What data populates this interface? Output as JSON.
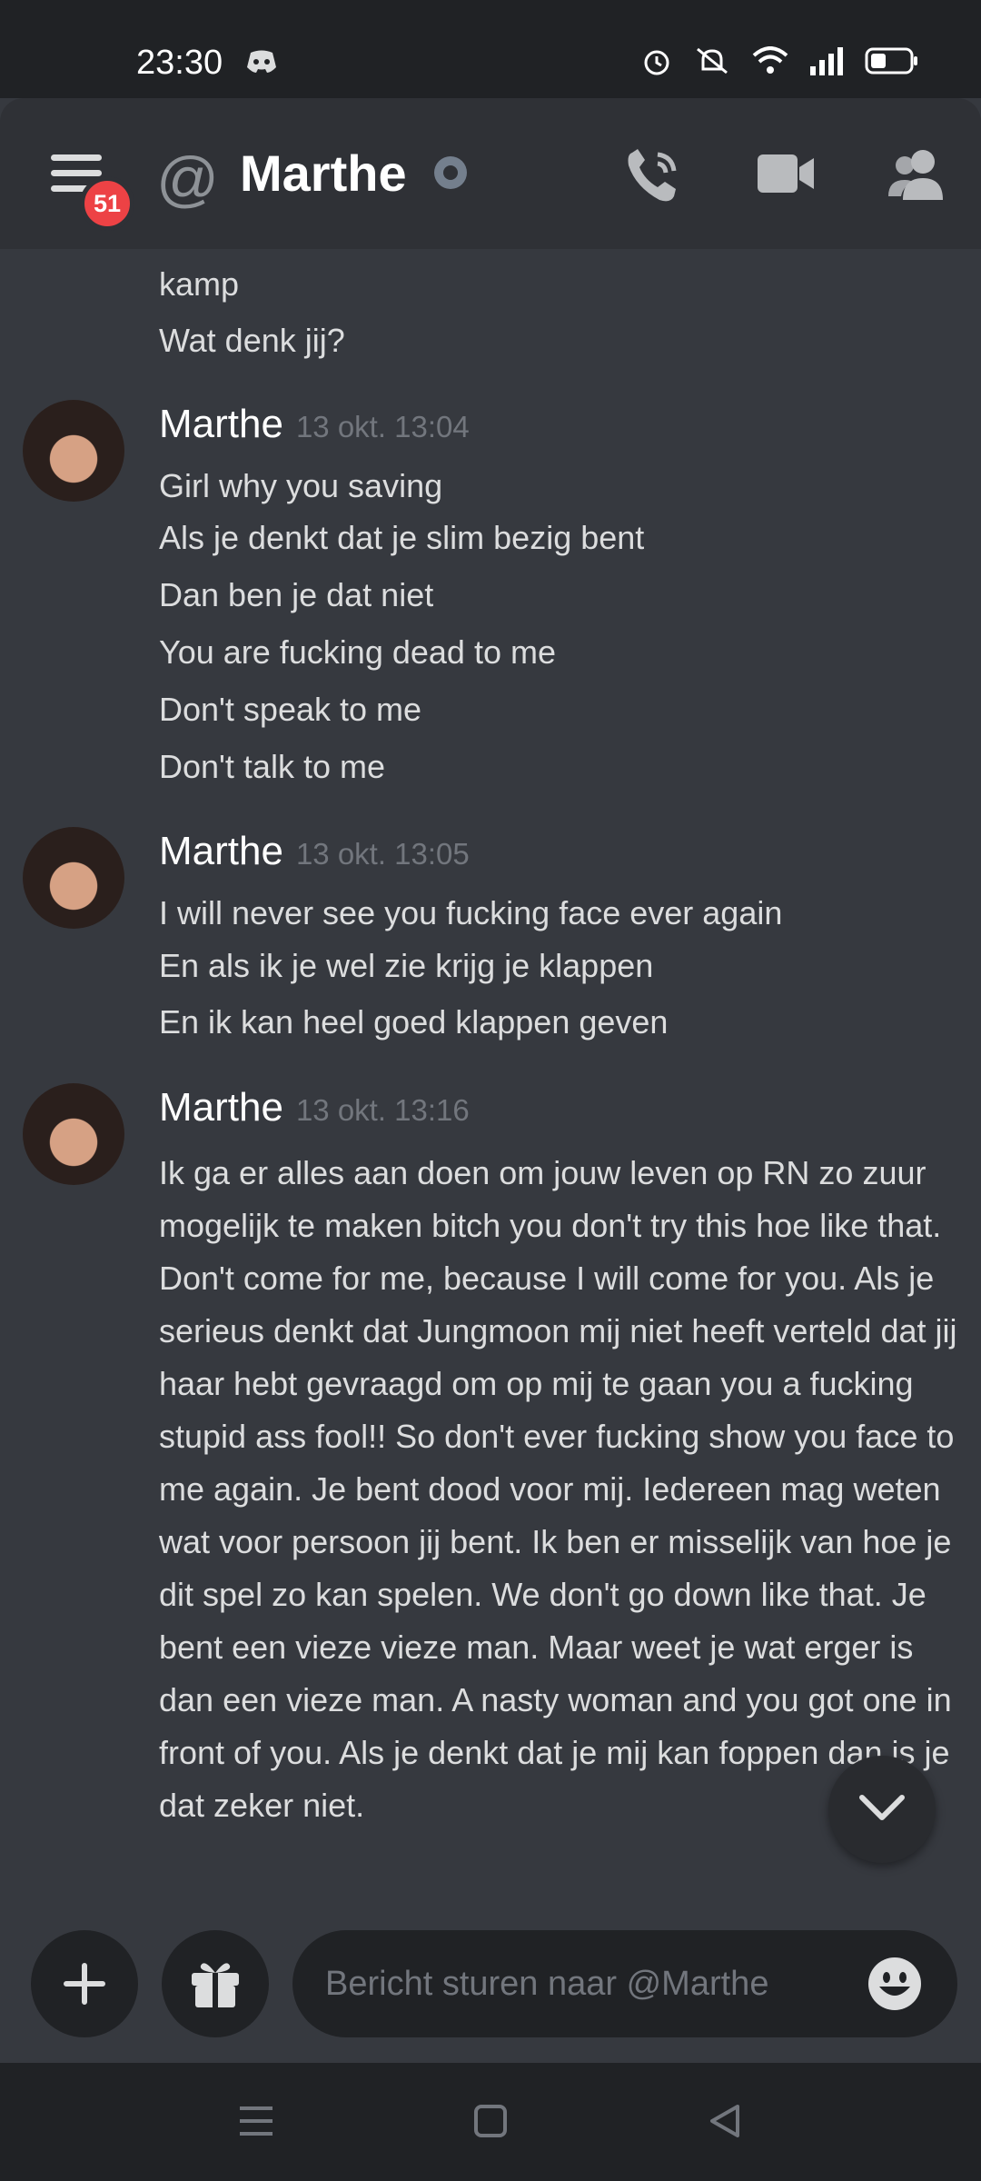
{
  "status_bar": {
    "time": "23:30"
  },
  "header": {
    "badge_count": "51",
    "title": "Marthe"
  },
  "chat": {
    "top_partial_lines": [
      "kamp",
      "Wat denk jij?"
    ],
    "groups": [
      {
        "author": "Marthe",
        "timestamp": "13 okt. 13:04",
        "lines": [
          "Girl why you saving",
          "Als je denkt dat je slim bezig bent",
          "Dan ben je dat niet",
          "You are fucking dead to me",
          "Don't speak to me",
          "Don't talk to me"
        ]
      },
      {
        "author": "Marthe",
        "timestamp": "13 okt. 13:05",
        "lines": [
          "I will never see you fucking face ever again",
          "En als ik je wel zie krijg je klappen",
          "En ik kan heel goed klappen geven"
        ]
      },
      {
        "author": "Marthe",
        "timestamp": "13 okt. 13:16",
        "paragraph": "Ik ga er alles aan doen om jouw leven op RN zo zuur mogelijk te maken bitch you don't try this hoe like that. Don't come for me, because I will come for you. Als je serieus denkt dat Jungmoon mij niet heeft verteld dat jij haar hebt gevraagd om op mij te gaan you a fucking stupid ass fool!! So don't ever fucking show you face to me again. Je bent dood voor mij. Iedereen mag weten wat voor persoon jij bent. Ik ben er misselijk van hoe je dit spel zo kan spelen. We don't go down like that. Je bent een vieze vieze man. Maar weet je wat erger is dan een vieze man. A nasty woman and you got one in front of you. Als je denkt dat je mij kan foppen dan is je dat zeker niet."
      }
    ]
  },
  "composer": {
    "placeholder": "Bericht sturen naar @Marthe"
  },
  "icons": {
    "menu": "hamburger-icon",
    "at": "at-icon",
    "status": "offline-status-icon",
    "call": "phone-icon",
    "video": "video-camera-icon",
    "members": "members-icon",
    "scroll": "chevron-down-icon",
    "add": "plus-icon",
    "gift": "gift-icon",
    "emoji": "emoji-icon"
  },
  "colors": {
    "background": "#36393f",
    "header": "#2f3136",
    "badge": "#ed4245",
    "muted": "#72767d"
  }
}
